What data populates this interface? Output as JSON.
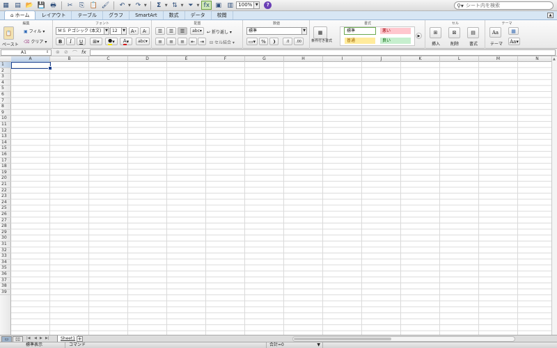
{
  "search": {
    "placeholder": "シート内を検索"
  },
  "zoom": "100%",
  "tabs": [
    {
      "label": "ホーム"
    },
    {
      "label": "レイアウト"
    },
    {
      "label": "テーブル"
    },
    {
      "label": "グラフ"
    },
    {
      "label": "SmartArt"
    },
    {
      "label": "数式"
    },
    {
      "label": "データ"
    },
    {
      "label": "校閲"
    }
  ],
  "ribbon": {
    "groups": {
      "edit": "編集",
      "font": "フォント",
      "align": "配置",
      "number": "数値",
      "format": "書式",
      "cells": "セル",
      "theme": "テーマ"
    },
    "paste": "ペースト",
    "fill": "フィル",
    "clear": "クリア",
    "font_name": "ＭＳ Ｐゴシック (本文)",
    "font_size": "12",
    "wrap_text": "折り返し",
    "merge": "セル結合",
    "number_format": "標準",
    "conditional_format": "条件付き書式",
    "styles": {
      "normal": "標準",
      "bad": "悪い",
      "neutral": "普通",
      "good": "良い"
    },
    "insert": "挿入",
    "delete": "削除",
    "format_btn": "書式",
    "theme_btn": "テーマ"
  },
  "formula_bar": {
    "cell_ref": "A1",
    "fx": "fx"
  },
  "columns": [
    "A",
    "B",
    "C",
    "D",
    "E",
    "F",
    "G",
    "H",
    "I",
    "J",
    "K",
    "L",
    "M",
    "N"
  ],
  "rows": [
    "1",
    "2",
    "3",
    "4",
    "5",
    "6",
    "7",
    "8",
    "9",
    "10",
    "11",
    "12",
    "13",
    "14",
    "15",
    "16",
    "17",
    "18",
    "19",
    "20",
    "21",
    "22",
    "23",
    "24",
    "25",
    "26",
    "27",
    "28",
    "29",
    "30",
    "31",
    "32",
    "33",
    "34",
    "35",
    "36",
    "37",
    "38",
    "39"
  ],
  "sheet": {
    "tab": "Sheet1",
    "add": "+"
  },
  "status": {
    "view": "標準表示",
    "command": "コマンド",
    "sum": "合計=0"
  },
  "colors": {
    "accent": "#1a3f8e",
    "tab_bar": "#d7e6f4",
    "style_normal_bg": "#ffffff",
    "style_bad_bg": "#ffc7ce",
    "style_neutral_bg": "#ffeb9c",
    "style_good_bg": "#c6efce"
  }
}
